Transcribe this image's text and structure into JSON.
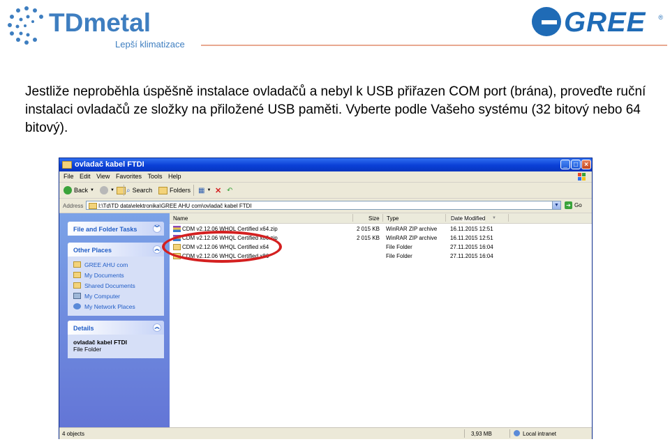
{
  "header": {
    "td_logo_text": "TDmetal",
    "td_logo_sub": "Lepší klimatizace",
    "gree_logo_text": "GREE",
    "gree_reg": "®"
  },
  "instruction": "Jestliže neproběhla úspěšně instalace ovladačů a nebyl k USB přiřazen COM port (brána), proveďte ruční instalaci ovladačů ze složky na přiložené USB paměti. Vyberte podle Vašeho systému (32 bitový nebo 64 bitový).",
  "window": {
    "title": "ovladač kabel FTDI",
    "menu": [
      "File",
      "Edit",
      "View",
      "Favorites",
      "Tools",
      "Help"
    ],
    "toolbar": {
      "back": "Back",
      "search": "Search",
      "folders": "Folders"
    },
    "address": {
      "label": "Address",
      "path": "I:\\Td\\TD data\\elektronika\\GREE AHU com\\ovladač kabel FTDI",
      "go": "Go"
    },
    "tasks": {
      "file_folder_tasks": "File and Folder Tasks",
      "other_places": "Other Places",
      "places": [
        "GREE AHU com",
        "My Documents",
        "Shared Documents",
        "My Computer",
        "My Network Places"
      ],
      "details_title": "Details",
      "details_name": "ovladač kabel FTDI",
      "details_type": "File Folder"
    },
    "columns": {
      "name": "Name",
      "size": "Size",
      "type": "Type",
      "date": "Date Modified"
    },
    "files": [
      {
        "name": "CDM v2.12.06 WHQL Certified x64.zip",
        "size": "2 015 KB",
        "type": "WinRAR ZIP archive",
        "date": "16.11.2015 12:51",
        "icon": "zip-icon"
      },
      {
        "name": "CDM v2.12.06 WHQL Certified x86.zip",
        "size": "2 015 KB",
        "type": "WinRAR ZIP archive",
        "date": "16.11.2015 12:51",
        "icon": "zip-icon"
      },
      {
        "name": "CDM v2.12.06 WHQL Certified x64",
        "size": "",
        "type": "File Folder",
        "date": "27.11.2015 16:04",
        "icon": "folder-icon"
      },
      {
        "name": "CDM v2.12.06 WHQL Certified x86",
        "size": "",
        "type": "File Folder",
        "date": "27.11.2015 16:04",
        "icon": "folder-icon"
      }
    ],
    "status": {
      "objects": "4 objects",
      "size": "3,93 MB",
      "zone": "Local intranet"
    }
  },
  "colors": {
    "xp_title_blue": "#0a3fd6",
    "task_link": "#215dc6",
    "highlight_red": "#d42020",
    "brand_blue": "#3e7ec0"
  }
}
